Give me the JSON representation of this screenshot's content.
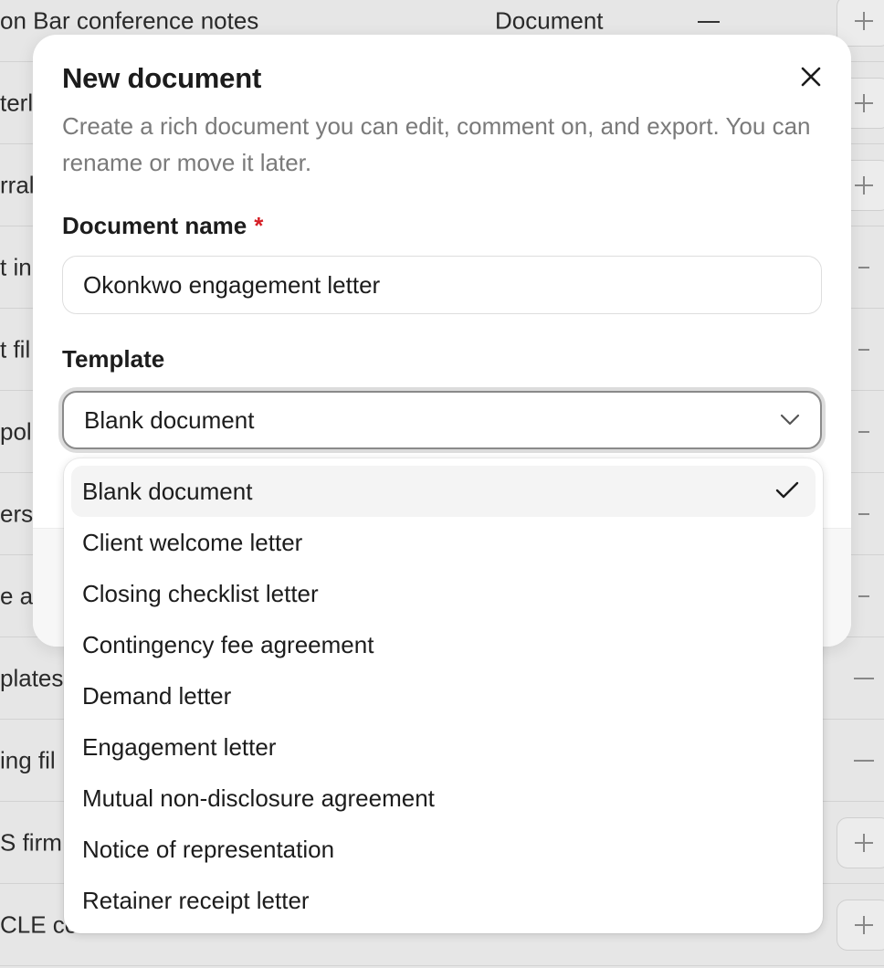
{
  "background": {
    "rows": [
      {
        "name": "on Bar conference notes",
        "type": "Document",
        "status": "—",
        "action": "plus"
      },
      {
        "name": "terl",
        "type": "",
        "status": "",
        "action": "plus"
      },
      {
        "name": "rral",
        "type": "",
        "status": "",
        "action": "plus"
      },
      {
        "name": "t in",
        "type": "",
        "status": "",
        "action": "minus-small"
      },
      {
        "name": "t fil",
        "type": "",
        "status": "",
        "action": "minus-small"
      },
      {
        "name": "pol",
        "type": "",
        "status": "",
        "action": "minus-small"
      },
      {
        "name": "ers",
        "type": "",
        "status": "",
        "action": "minus-small"
      },
      {
        "name": "e ar",
        "type": "",
        "status": "",
        "action": "minus-small"
      },
      {
        "name": "plates",
        "type": "",
        "status": "",
        "action": "minus"
      },
      {
        "name": "ing fil",
        "type": "",
        "status": "",
        "action": "minus"
      },
      {
        "name": "S firm",
        "type": "",
        "status": "",
        "action": "plus"
      },
      {
        "name": "CLE ce",
        "type": "",
        "status": "",
        "action": "plus"
      }
    ]
  },
  "modal": {
    "title": "New document",
    "description": "Create a rich document you can edit, comment on, and export. You can rename or move it later.",
    "name_label": "Document name",
    "required_mark": "*",
    "name_value": "Okonkwo engagement letter",
    "template_label": "Template",
    "template_value": "Blank document",
    "close_icon": "close-icon",
    "chevron_icon": "chevron-down-icon"
  },
  "dropdown": {
    "options": [
      {
        "label": "Blank document",
        "selected": true
      },
      {
        "label": "Client welcome letter",
        "selected": false
      },
      {
        "label": "Closing checklist letter",
        "selected": false
      },
      {
        "label": "Contingency fee agreement",
        "selected": false
      },
      {
        "label": "Demand letter",
        "selected": false
      },
      {
        "label": "Engagement letter",
        "selected": false
      },
      {
        "label": "Mutual non-disclosure agreement",
        "selected": false
      },
      {
        "label": "Notice of representation",
        "selected": false
      },
      {
        "label": "Retainer receipt letter",
        "selected": false
      }
    ],
    "check_icon": "check-icon"
  },
  "colors": {
    "required": "#d61f26",
    "backdrop": "#e6e6e6",
    "selected_option_bg": "#f4f4f4"
  }
}
